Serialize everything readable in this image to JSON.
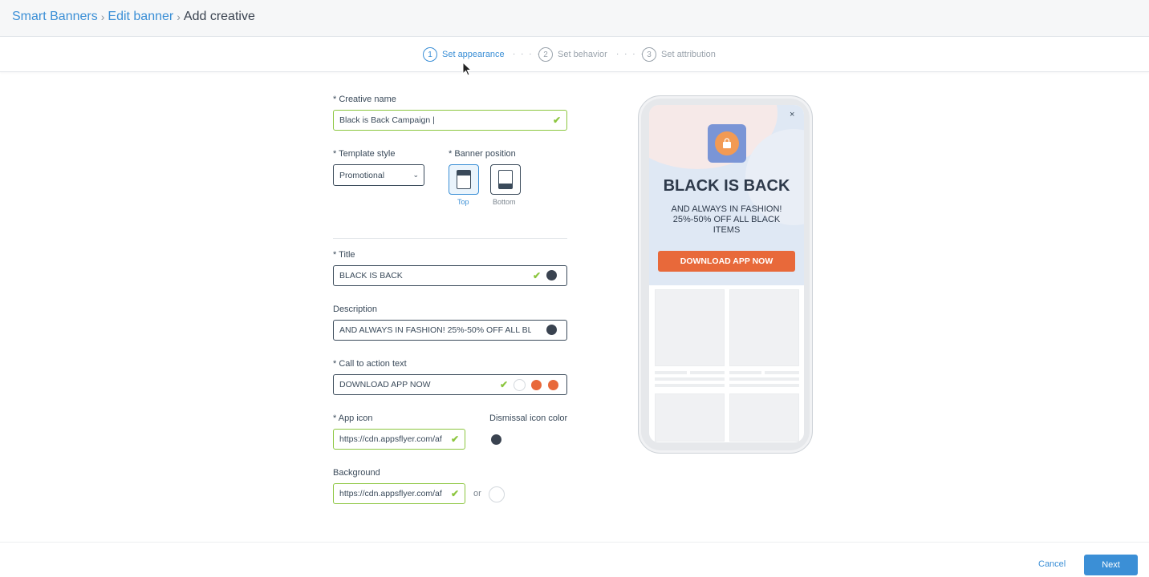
{
  "breadcrumb": {
    "items": [
      "Smart Banners",
      "Edit banner"
    ],
    "separator": "›",
    "current": "Add creative"
  },
  "stepper": {
    "steps": [
      {
        "num": "1",
        "label": "Set appearance",
        "active": true
      },
      {
        "num": "2",
        "label": "Set behavior",
        "active": false
      },
      {
        "num": "3",
        "label": "Set attribution",
        "active": false
      }
    ],
    "separator": "· · · ·"
  },
  "form": {
    "creative_name": {
      "label": "* Creative name",
      "value": "Black is Back Campaign |"
    },
    "template_style": {
      "label": "* Template style",
      "value": "Promotional"
    },
    "banner_position": {
      "label": "* Banner position",
      "options": [
        "Top",
        "Bottom"
      ],
      "selected": "Top"
    },
    "title": {
      "label": "* Title",
      "value": "BLACK IS BACK",
      "color": "#3a4350"
    },
    "description": {
      "label": "Description",
      "value": "AND ALWAYS IN FASHION! 25%-50% OFF ALL BLAC",
      "color": "#3a4350"
    },
    "cta": {
      "label": "* Call to action text",
      "value": "DOWNLOAD APP NOW",
      "colors": [
        "#ffffff",
        "#e8693a",
        "#e8693a"
      ]
    },
    "app_icon": {
      "label": "* App icon",
      "value": "https://cdn.appsflyer.com/af"
    },
    "dismissal_icon": {
      "label": "Dismissal icon color",
      "color": "#3a4350"
    },
    "background": {
      "label": "Background",
      "value": "https://cdn.appsflyer.com/af",
      "or": "or",
      "color": "#ffffff"
    }
  },
  "preview": {
    "title": "BLACK IS BACK",
    "description": "AND ALWAYS IN FASHION! 25%-50% OFF ALL BLACK ITEMS",
    "cta": "DOWNLOAD APP NOW",
    "close": "×",
    "cta_color": "#e8693a"
  },
  "footer": {
    "cancel": "Cancel",
    "next": "Next"
  },
  "icons": {
    "check": "✔",
    "chevron": "⌄"
  }
}
